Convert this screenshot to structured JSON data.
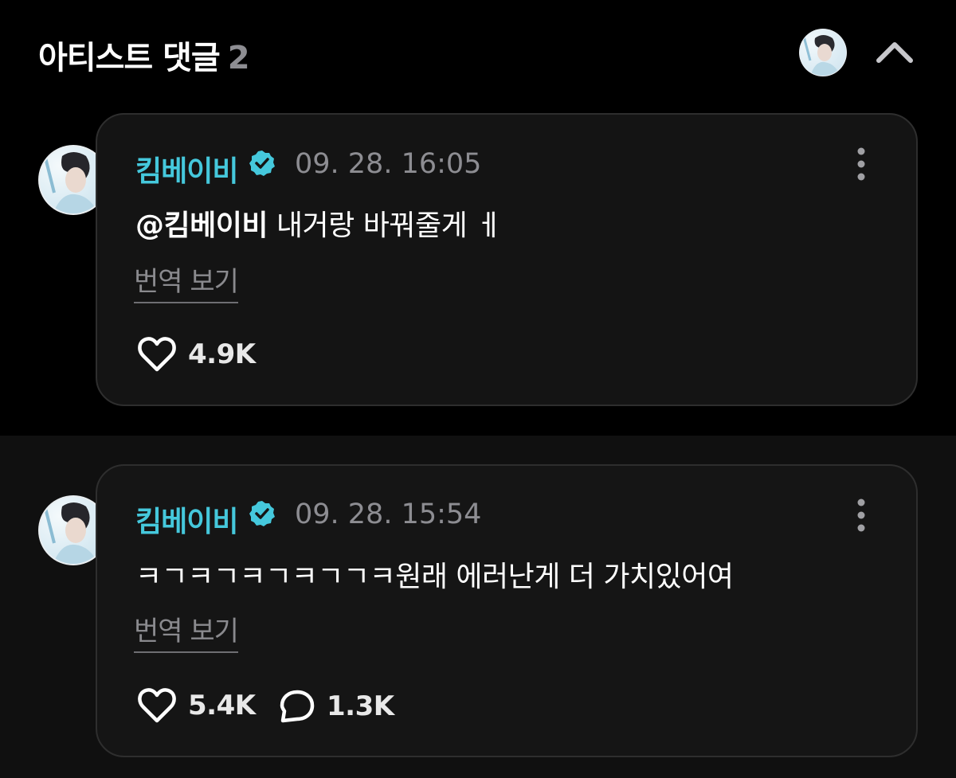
{
  "header": {
    "title": "아티스트 댓글",
    "count": "2"
  },
  "comments": [
    {
      "author": "킴베이비",
      "timestamp": "09. 28. 16:05",
      "mention": "@킴베이비",
      "text": " 내거랑 바꿔줄게 ㅔ",
      "translate_label": "번역 보기",
      "likes": "4.9K"
    },
    {
      "author": "킴베이비",
      "timestamp": "09. 28. 15:54",
      "text": "ㅋㄱㅋㄱㅋㄱㅋㄱㄱㅋ원래 에러난게 더 가치있어여",
      "translate_label": "번역 보기",
      "likes": "5.4K",
      "replies": "1.3K"
    }
  ],
  "colors": {
    "accent": "#45c8dc",
    "background": "#000000",
    "card": "#141414",
    "muted_text": "#8d8d92"
  },
  "icons": [
    "verified-badge-icon",
    "heart-icon",
    "comment-bubble-icon",
    "more-vertical-icon",
    "chevron-up-icon"
  ]
}
